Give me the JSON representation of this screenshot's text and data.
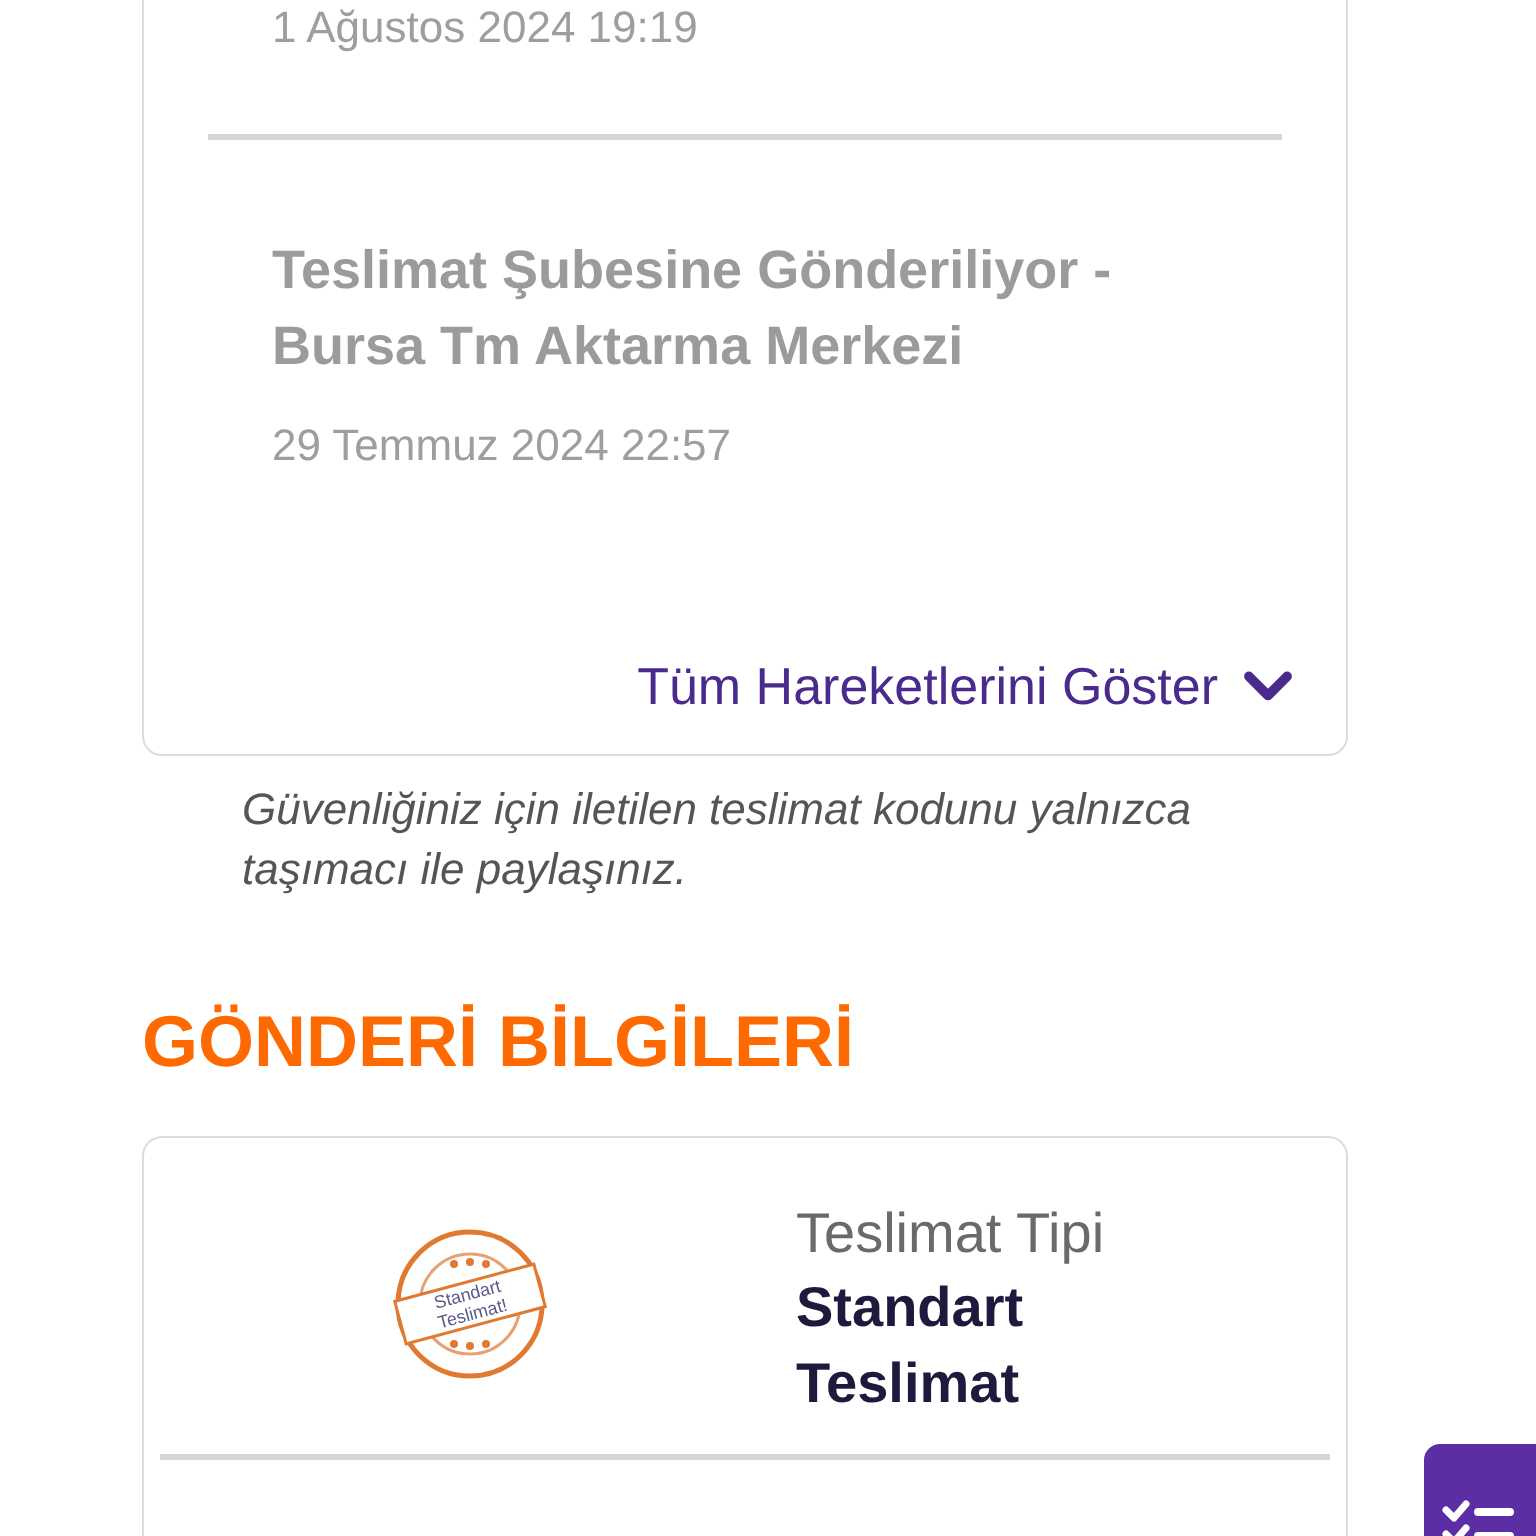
{
  "tracking": {
    "events": [
      {
        "date": "1 Ağustos 2024 19:19"
      },
      {
        "title": "Teslimat Şubesine Gönderiliyor - Bursa Tm Aktarma Merkezi",
        "date": "29 Temmuz 2024 22:57"
      }
    ],
    "show_all_link": "Tüm Hareketlerini Göster"
  },
  "security_note": "Güvenliğiniz için iletilen teslimat kodunu yalnızca taşımacı ile paylaşınız.",
  "shipment_info": {
    "heading": "GÖNDERİ BİLGİLERİ",
    "stamp_text": [
      "Standart",
      "Teslimat!"
    ],
    "label": "Teslimat Tipi",
    "value": "Standart Teslimat"
  }
}
